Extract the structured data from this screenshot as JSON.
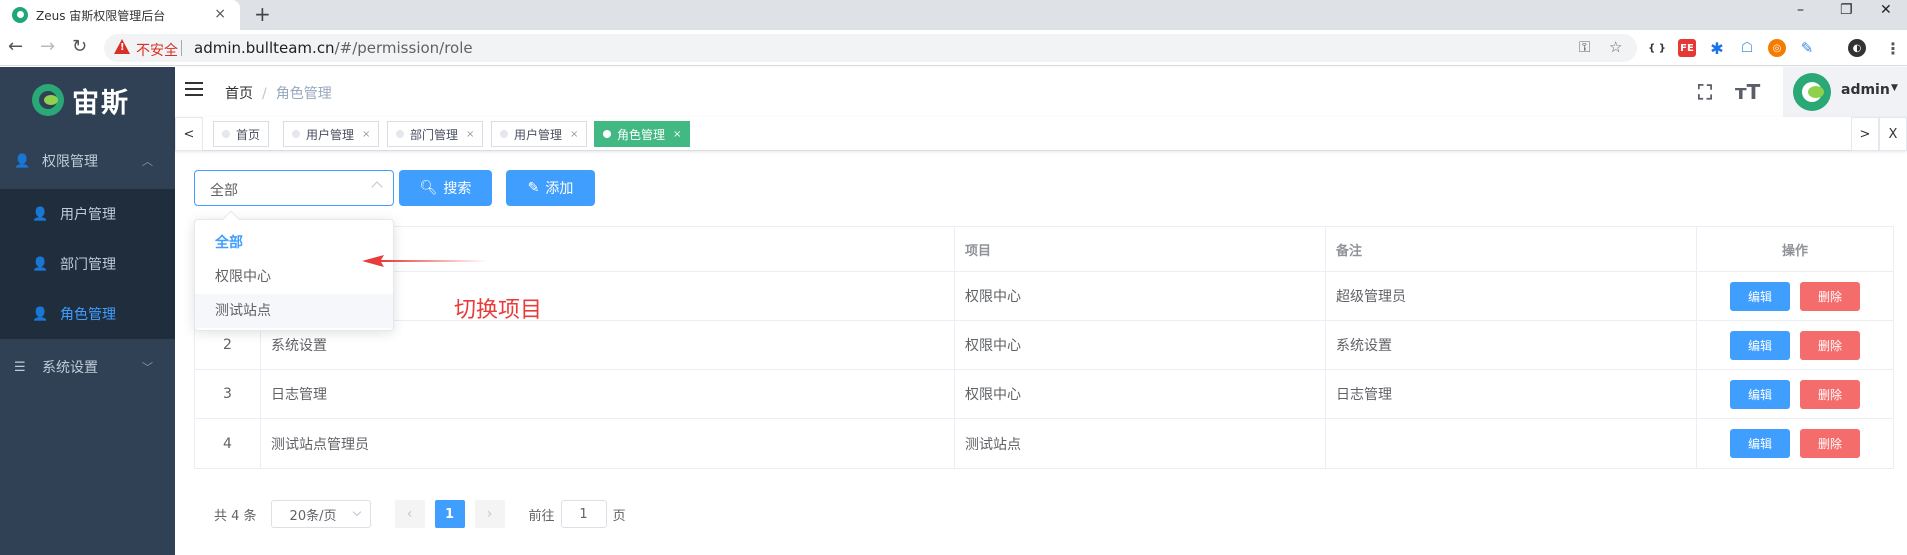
{
  "browser": {
    "tab_title": "Zeus 宙斯权限管理后台",
    "tab_close": "×",
    "new_tab": "+",
    "insecure_label": "不安全",
    "url_host": "admin.bullteam.cn",
    "url_path": "/#/permission/role",
    "window_controls": [
      "–",
      "❐",
      "✕"
    ],
    "nav": {
      "back": "←",
      "forward": "→",
      "reload": "↻"
    }
  },
  "sidebar": {
    "logo_text": "宙斯",
    "groups": [
      {
        "label": "权限管理",
        "expanded": true,
        "items": [
          {
            "label": "用户管理",
            "active": false
          },
          {
            "label": "部门管理",
            "active": false
          },
          {
            "label": "角色管理",
            "active": true
          }
        ]
      },
      {
        "label": "系统设置",
        "expanded": false,
        "items": []
      }
    ]
  },
  "navbar": {
    "breadcrumb": [
      "首页",
      "角色管理"
    ],
    "breadcrumb_sep": "/",
    "fullscreen_icon": "⛶",
    "size_icon": "тT",
    "user": "admin"
  },
  "tags": {
    "prev": "<",
    "next": ">",
    "close_all": "X",
    "items": [
      {
        "label": "首页",
        "closable": false,
        "active": false
      },
      {
        "label": "用户管理",
        "closable": true,
        "active": false
      },
      {
        "label": "部门管理",
        "closable": true,
        "active": false
      },
      {
        "label": "用户管理",
        "closable": true,
        "active": false
      },
      {
        "label": "角色管理",
        "closable": true,
        "active": true
      }
    ],
    "close_glyph": "×"
  },
  "filter": {
    "project_value": "全部",
    "search_label": "搜索",
    "add_label": "添加",
    "options": [
      {
        "label": "全部",
        "selected": true
      },
      {
        "label": "权限中心",
        "selected": false
      },
      {
        "label": "测试站点",
        "selected": false
      }
    ]
  },
  "annotation": {
    "text": "切换项目",
    "color": "#e83b3b"
  },
  "table": {
    "columns": [
      "",
      "",
      "项目",
      "备注",
      "操作"
    ],
    "rows": [
      {
        "idx": "1",
        "name": "",
        "project": "权限中心",
        "note": "超级管理员"
      },
      {
        "idx": "2",
        "name": "系统设置",
        "project": "权限中心",
        "note": "系统设置"
      },
      {
        "idx": "3",
        "name": "日志管理",
        "project": "权限中心",
        "note": "日志管理"
      },
      {
        "idx": "4",
        "name": "测试站点管理员",
        "project": "测试站点",
        "note": ""
      }
    ],
    "edit_label": "编辑",
    "delete_label": "删除"
  },
  "pagination": {
    "total": "共 4 条",
    "page_size": "20条/页",
    "prev": "‹",
    "next": "›",
    "current_page": "1",
    "goto_prefix": "前往",
    "goto_value": "1",
    "goto_suffix": "页"
  },
  "colors": {
    "primary": "#409eff",
    "danger": "#f56c6c",
    "sidebar_bg": "#304156",
    "active_tag": "#42b983"
  }
}
